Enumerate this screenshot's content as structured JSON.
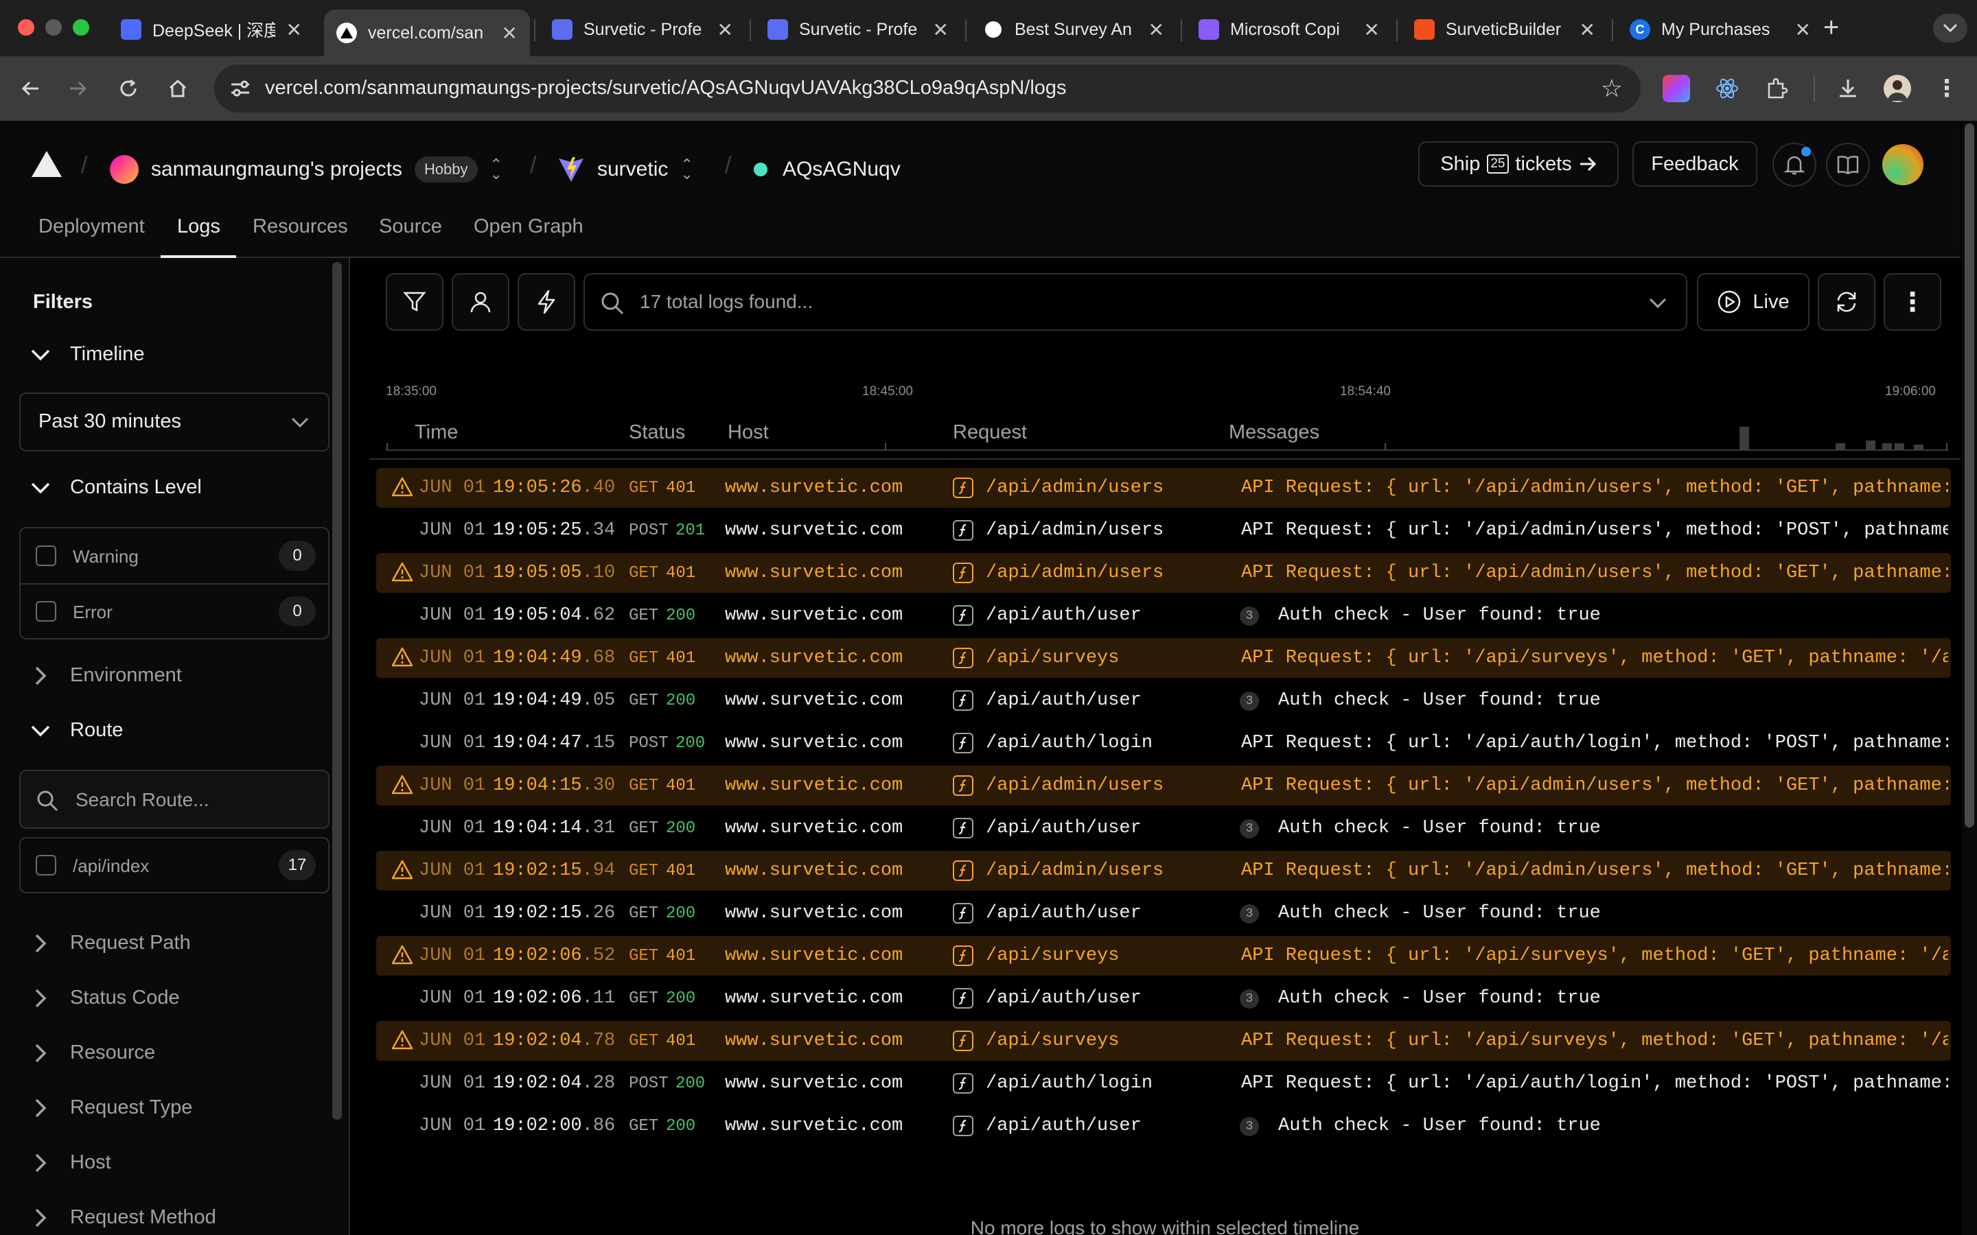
{
  "browser": {
    "tabs": [
      {
        "title": "DeepSeek | 深度",
        "icon": "deepseek-icon",
        "color": "#4d6bfe"
      },
      {
        "title": "vercel.com/san",
        "icon": "vercel-icon",
        "color": "#000000"
      },
      {
        "title": "Survetic - Profe",
        "icon": "doc-icon",
        "color": "#5b6cf0"
      },
      {
        "title": "Survetic - Profe",
        "icon": "doc-icon",
        "color": "#5b6cf0"
      },
      {
        "title": "Best Survey An",
        "icon": "openai-icon",
        "color": "#ffffff"
      },
      {
        "title": "Microsoft Copi",
        "icon": "copilot-icon",
        "color": "#8a5cf6"
      },
      {
        "title": "SurveticBuilder",
        "icon": "figma-icon",
        "color": "#f24e1e"
      },
      {
        "title": "My Purchases",
        "icon": "c-icon",
        "color": "#1a73e8"
      }
    ],
    "url": "vercel.com/sanmaungmaungs-projects/survetic/AQsAGNuqvUAVAkg38CLo9a9qAspN/logs"
  },
  "header": {
    "team": "sanmaungmaung's projects",
    "plan": "Hobby",
    "project": "survetic",
    "deployment": "AQsAGNuqv",
    "ship_prefix": "Ship",
    "ship_count": "25",
    "ship_suffix": "tickets",
    "feedback": "Feedback",
    "nav": [
      "Deployment",
      "Logs",
      "Resources",
      "Source",
      "Open Graph"
    ]
  },
  "sidebar": {
    "title": "Filters",
    "timeline_label": "Timeline",
    "timeline_value": "Past 30 minutes",
    "level_label": "Contains Level",
    "levels": [
      {
        "label": "Warning",
        "count": "0"
      },
      {
        "label": "Error",
        "count": "0"
      }
    ],
    "environment_label": "Environment",
    "route_label": "Route",
    "route_search_placeholder": "Search Route...",
    "routes": [
      {
        "label": "/api/index",
        "count": "17"
      }
    ],
    "sections": [
      "Request Path",
      "Status Code",
      "Resource",
      "Request Type",
      "Host",
      "Request Method"
    ]
  },
  "toolbar": {
    "search_placeholder": "17 total logs found...",
    "live_label": "Live"
  },
  "histogram": {
    "ticks": [
      "18:35:00",
      "18:45:00",
      "18:54:40",
      "19:06:00"
    ]
  },
  "columns": [
    "Time",
    "Status",
    "Host",
    "Request",
    "Messages"
  ],
  "logs": [
    {
      "level": "warn",
      "date": "JUN 01",
      "time": "19:05:26",
      "ms": ".40",
      "method": "GET",
      "status": "401",
      "host": "www.survetic.com",
      "path": "/api/admin/users",
      "badge": "",
      "message": "API Request: { url: '/api/admin/users', method: 'GET', pathname: '/api/admin/users' }"
    },
    {
      "level": "info",
      "date": "JUN 01",
      "time": "19:05:25",
      "ms": ".34",
      "method": "POST",
      "status": "201",
      "host": "www.survetic.com",
      "path": "/api/admin/users",
      "badge": "",
      "message": "API Request: { url: '/api/admin/users', method: 'POST', pathname: '/api/admin/users' }"
    },
    {
      "level": "warn",
      "date": "JUN 01",
      "time": "19:05:05",
      "ms": ".10",
      "method": "GET",
      "status": "401",
      "host": "www.survetic.com",
      "path": "/api/admin/users",
      "badge": "",
      "message": "API Request: { url: '/api/admin/users', method: 'GET', pathname: '/api/admin/users' }"
    },
    {
      "level": "info",
      "date": "JUN 01",
      "time": "19:05:04",
      "ms": ".62",
      "method": "GET",
      "status": "200",
      "host": "www.survetic.com",
      "path": "/api/auth/user",
      "badge": "3",
      "message": "Auth check - User found: true"
    },
    {
      "level": "warn",
      "date": "JUN 01",
      "time": "19:04:49",
      "ms": ".68",
      "method": "GET",
      "status": "401",
      "host": "www.survetic.com",
      "path": "/api/surveys",
      "badge": "",
      "message": "API Request: { url: '/api/surveys', method: 'GET', pathname: '/api/surveys' }"
    },
    {
      "level": "info",
      "date": "JUN 01",
      "time": "19:04:49",
      "ms": ".05",
      "method": "GET",
      "status": "200",
      "host": "www.survetic.com",
      "path": "/api/auth/user",
      "badge": "3",
      "message": "Auth check - User found: true"
    },
    {
      "level": "info",
      "date": "JUN 01",
      "time": "19:04:47",
      "ms": ".15",
      "method": "POST",
      "status": "200",
      "host": "www.survetic.com",
      "path": "/api/auth/login",
      "badge": "",
      "message": "API Request: { url: '/api/auth/login', method: 'POST', pathname: '/api/auth/login' }"
    },
    {
      "level": "warn",
      "date": "JUN 01",
      "time": "19:04:15",
      "ms": ".30",
      "method": "GET",
      "status": "401",
      "host": "www.survetic.com",
      "path": "/api/admin/users",
      "badge": "",
      "message": "API Request: { url: '/api/admin/users', method: 'GET', pathname: '/api/admin/users' }"
    },
    {
      "level": "info",
      "date": "JUN 01",
      "time": "19:04:14",
      "ms": ".31",
      "method": "GET",
      "status": "200",
      "host": "www.survetic.com",
      "path": "/api/auth/user",
      "badge": "3",
      "message": "Auth check - User found: true"
    },
    {
      "level": "warn",
      "date": "JUN 01",
      "time": "19:02:15",
      "ms": ".94",
      "method": "GET",
      "status": "401",
      "host": "www.survetic.com",
      "path": "/api/admin/users",
      "badge": "",
      "message": "API Request: { url: '/api/admin/users', method: 'GET', pathname: '/api/admin/users' }"
    },
    {
      "level": "info",
      "date": "JUN 01",
      "time": "19:02:15",
      "ms": ".26",
      "method": "GET",
      "status": "200",
      "host": "www.survetic.com",
      "path": "/api/auth/user",
      "badge": "3",
      "message": "Auth check - User found: true"
    },
    {
      "level": "warn",
      "date": "JUN 01",
      "time": "19:02:06",
      "ms": ".52",
      "method": "GET",
      "status": "401",
      "host": "www.survetic.com",
      "path": "/api/surveys",
      "badge": "",
      "message": "API Request: { url: '/api/surveys', method: 'GET', pathname: '/api/surveys' }"
    },
    {
      "level": "info",
      "date": "JUN 01",
      "time": "19:02:06",
      "ms": ".11",
      "method": "GET",
      "status": "200",
      "host": "www.survetic.com",
      "path": "/api/auth/user",
      "badge": "3",
      "message": "Auth check - User found: true"
    },
    {
      "level": "warn",
      "date": "JUN 01",
      "time": "19:02:04",
      "ms": ".78",
      "method": "GET",
      "status": "401",
      "host": "www.survetic.com",
      "path": "/api/surveys",
      "badge": "",
      "message": "API Request: { url: '/api/surveys', method: 'GET', pathname: '/api/surveys' }"
    },
    {
      "level": "info",
      "date": "JUN 01",
      "time": "19:02:04",
      "ms": ".28",
      "method": "POST",
      "status": "200",
      "host": "www.survetic.com",
      "path": "/api/auth/login",
      "badge": "",
      "message": "API Request: { url: '/api/auth/login', method: 'POST', pathname: '/api/auth/login' }"
    },
    {
      "level": "info",
      "date": "JUN 01",
      "time": "19:02:00",
      "ms": ".86",
      "method": "GET",
      "status": "200",
      "host": "www.survetic.com",
      "path": "/api/auth/user",
      "badge": "3",
      "message": "Auth check - User found: true"
    }
  ],
  "footer_text": "No more logs to show within selected timeline",
  "colors": {
    "warning": "#f5a524",
    "success": "#45c26b",
    "live_dot": "#50e3c2"
  }
}
